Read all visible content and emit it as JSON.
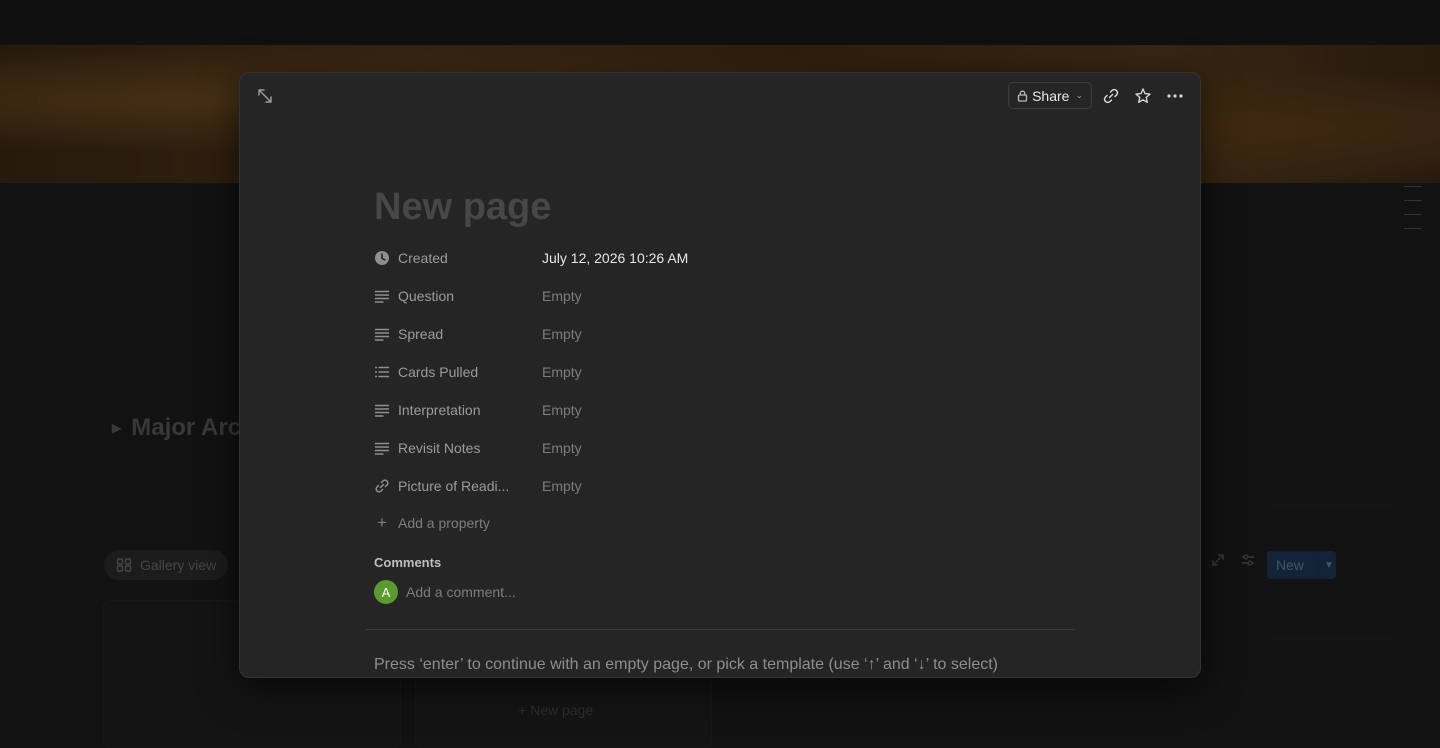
{
  "background": {
    "heading": "Major Arca",
    "gallery_view_label": "Gallery view",
    "new_page_label": "New page",
    "new_button_label": "New"
  },
  "modal": {
    "share_label": "Share",
    "title_placeholder": "New page",
    "properties": [
      {
        "name": "Created",
        "icon": "clock-icon",
        "value": "July 12, 2026 10:26 AM"
      },
      {
        "name": "Question",
        "icon": "text-lines-icon",
        "value": "Empty"
      },
      {
        "name": "Spread",
        "icon": "text-lines-icon",
        "value": "Empty"
      },
      {
        "name": "Cards Pulled",
        "icon": "bulleted-list-icon",
        "value": "Empty"
      },
      {
        "name": "Interpretation",
        "icon": "text-lines-icon",
        "value": "Empty"
      },
      {
        "name": "Revisit Notes",
        "icon": "text-lines-icon",
        "value": "Empty"
      },
      {
        "name": "Picture of Readi...",
        "icon": "link-icon",
        "value": "Empty"
      }
    ],
    "add_property_label": "Add a property",
    "comments_label": "Comments",
    "avatar_initial": "A",
    "comment_placeholder": "Add a comment...",
    "template_hint": "Press ‘enter’ to continue with an empty page, or pick a template (use ‘↑’ and ‘↓’ to select)"
  }
}
